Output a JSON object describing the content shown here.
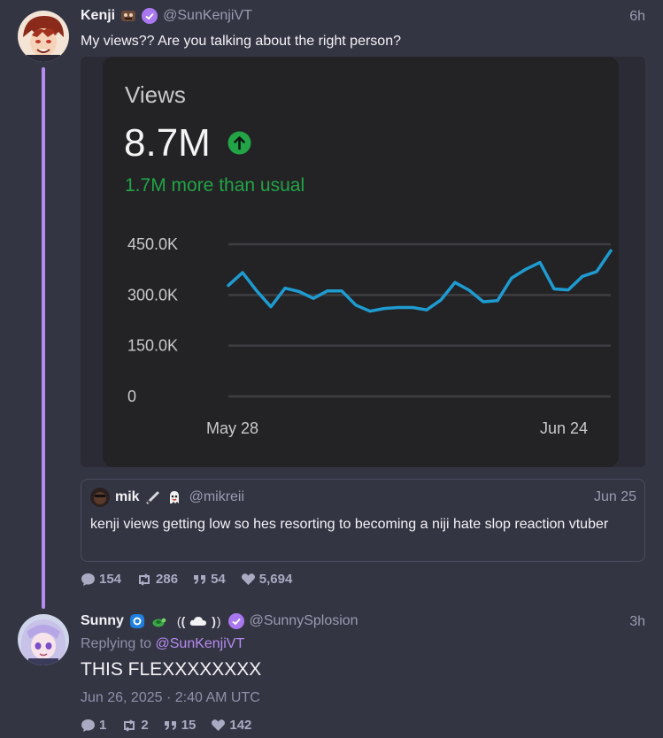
{
  "post1": {
    "name": "Kenji",
    "handle": "@SunKenjiVT",
    "time": "6h",
    "text": "My views?? Are you talking about the right person?",
    "stats": {
      "replies": "154",
      "reposts": "286",
      "quotes": "54",
      "likes": "5,694"
    }
  },
  "views_card": {
    "title": "Views",
    "value": "8.7M",
    "delta_text": "1.7M more than usual",
    "accent": "#1e9bd0",
    "positive": "#22a447"
  },
  "quote": {
    "name": "mik",
    "handle": "@mikreii",
    "time": "Jun 25",
    "text": "kenji views getting low so hes resorting to becoming a niji hate slop reaction vtuber"
  },
  "post2": {
    "name": "Sunny",
    "handle": "@SunnySplosion",
    "time": "3h",
    "replying_prefix": "Replying to ",
    "replying_to": "@SunKenjiVT",
    "text": "THIS FLEXXXXXXXX",
    "timestamp": "Jun 26, 2025 · 2:40 AM UTC",
    "stats": {
      "replies": "1",
      "reposts": "2",
      "quotes": "15",
      "likes": "142"
    }
  },
  "chart_data": {
    "type": "line",
    "x_start_label": "May 28",
    "x_end_label": "Jun 24",
    "ytick_labels": [
      "450.0K",
      "300.0K",
      "150.0K",
      "0"
    ],
    "yticks": [
      450000,
      300000,
      150000,
      0
    ],
    "ylim": [
      0,
      450000
    ],
    "grid": true,
    "series": [
      {
        "values": [
          328000,
          366000,
          312000,
          265000,
          320000,
          310000,
          290000,
          312000,
          312000,
          270000,
          252000,
          260000,
          263000,
          263000,
          256000,
          285000,
          337000,
          314000,
          280000,
          283000,
          350000,
          376000,
          396000,
          318000,
          315000,
          355000,
          369000,
          431000
        ]
      }
    ]
  }
}
